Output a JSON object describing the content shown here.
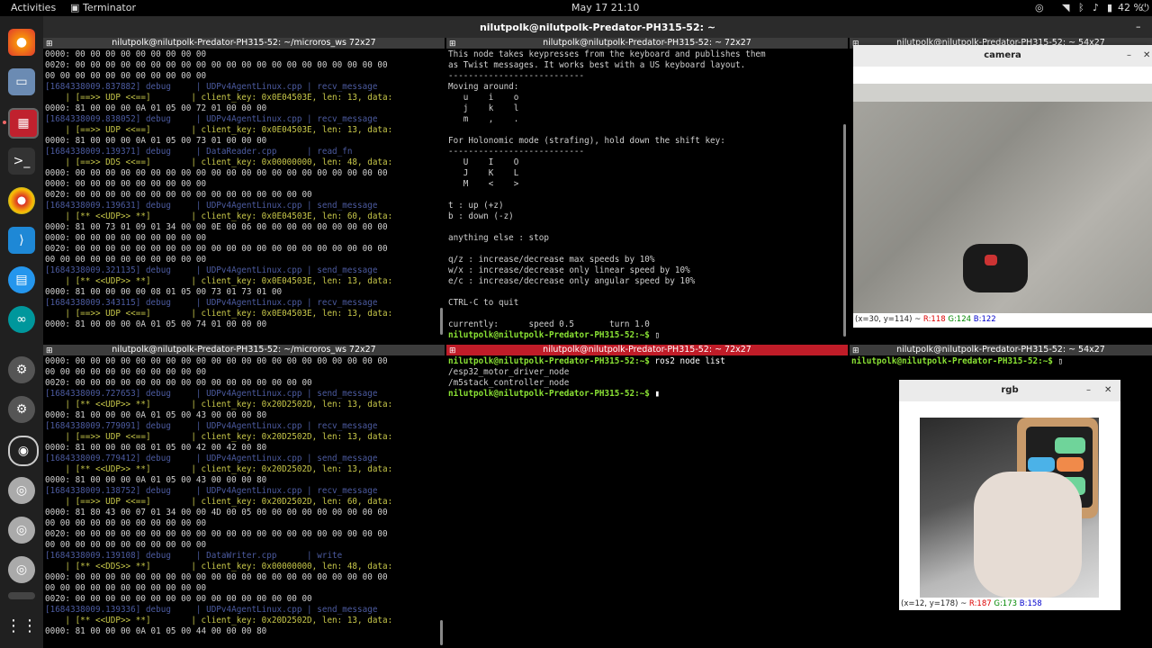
{
  "topbar": {
    "activities": "Activities",
    "app_name": "Terminator",
    "datetime": "May 17  21:10",
    "battery": "42 %"
  },
  "window_title": "nilutpolk@nilutpolk-Predator-PH315-52: ~",
  "panes": {
    "tl": {
      "title": "nilutpolk@nilutpolk-Predator-PH315-52: ~/microros_ws 72x27",
      "lines": [
        "0000: 00 00 00 00 00 00 00 00 00",
        "0020: 00 00 00 00 00 00 00 00 00 00 00 00 00 00 00 00 00 00 00 00 00",
        "00 00 00 00 00 00 00 00 00 00 00",
        "[1684338009.837882] debug     | UDPv4AgentLinux.cpp | recv_message",
        "    | [==>> UDP <<==]        | client_key: 0x0E04503E, len: 13, data:",
        "0000: 81 00 00 00 0A 01 05 00 72 01 00 00 00",
        "[1684338009.838052] debug     | UDPv4AgentLinux.cpp | recv_message",
        "    | [==>> UDP <<==]        | client_key: 0x0E04503E, len: 13, data:",
        "0000: 81 00 00 00 0A 01 05 00 73 01 00 00 00",
        "[1684338009.139371] debug     | DataReader.cpp      | read_fn",
        "    | [==>> DDS <<==]        | client_key: 0x00000000, len: 48, data:",
        "0000: 00 00 00 00 00 00 00 00 00 00 00 00 00 00 00 00 00 00 00 00 00",
        "0000: 00 00 00 00 00 00 00 00 00",
        "0020: 00 00 00 00 00 00 00 00 00 00 00 00 00 00 00 00",
        "[1684338009.139631] debug     | UDPv4AgentLinux.cpp | send_message",
        "    | [** <<UDP>> **]        | client_key: 0x0E04503E, len: 60, data:",
        "0000: 81 00 73 01 09 01 34 00 00 0E 00 06 00 00 00 00 00 00 00 00 00",
        "0000: 00 00 00 00 00 00 00 00 00",
        "0020: 00 00 00 00 00 00 00 00 00 00 00 00 00 00 00 00 00 00 00 00 00",
        "00 00 00 00 00 00 00 00 00 00 00",
        "[1684338009.321135] debug     | UDPv4AgentLinux.cpp | send_message",
        "    | [** <<UDP>> **]        | client_key: 0x0E04503E, len: 13, data:",
        "0000: 81 00 00 00 00 08 01 05 00 73 01 73 01 00",
        "[1684338009.343115] debug     | UDPv4AgentLinux.cpp | recv_message",
        "    | [==>> UDP <<==]        | client_key: 0x0E04503E, len: 13, data:",
        "0000: 81 00 00 00 0A 01 05 00 74 01 00 00 00"
      ]
    },
    "tm": {
      "title": "nilutpolk@nilutpolk-Predator-PH315-52: ~ 72x27",
      "lines": [
        "This node takes keypresses from the keyboard and publishes them",
        "as Twist messages. It works best with a US keyboard layout.",
        "---------------------------",
        "Moving around:",
        "   u    i    o",
        "   j    k    l",
        "   m    ,    .",
        "",
        "For Holonomic mode (strafing), hold down the shift key:",
        "---------------------------",
        "   U    I    O",
        "   J    K    L",
        "   M    <    >",
        "",
        "t : up (+z)",
        "b : down (-z)",
        "",
        "anything else : stop",
        "",
        "q/z : increase/decrease max speeds by 10%",
        "w/x : increase/decrease only linear speed by 10%",
        "e/c : increase/decrease only angular speed by 10%",
        "",
        "CTRL-C to quit",
        "",
        "currently:      speed 0.5       turn 1.0"
      ],
      "prompt": "nilutpolk@nilutpolk-Predator-PH315-52:~$"
    },
    "tr": {
      "title": "nilutpolk@nilutpolk-Predator-PH315-52: ~ 54x27"
    },
    "bl": {
      "title": "nilutpolk@nilutpolk-Predator-PH315-52: ~/microros_ws 72x27",
      "lines": [
        "0000: 00 00 00 00 00 00 00 00 00 00 00 00 00 00 00 00 00 00 00 00 00",
        "00 00 00 00 00 00 00 00 00 00 00",
        "0020: 00 00 00 00 00 00 00 00 00 00 00 00 00 00 00 00",
        "[1684338009.727653] debug     | UDPv4AgentLinux.cpp | send_message",
        "    | [** <<UDP>> **]        | client_key: 0x20D2502D, len: 13, data:",
        "0000: 81 00 00 00 0A 01 05 00 43 00 00 00 80",
        "[1684338009.779091] debug     | UDPv4AgentLinux.cpp | recv_message",
        "    | [==>> UDP <<==]        | client_key: 0x20D2502D, len: 13, data:",
        "0000: 81 00 00 00 08 01 05 00 42 00 42 00 80",
        "[1684338009.779412] debug     | UDPv4AgentLinux.cpp | send_message",
        "    | [** <<UDP>> **]        | client_key: 0x20D2502D, len: 13, data:",
        "0000: 81 00 00 00 0A 01 05 00 43 00 00 00 80",
        "[1684338009.138752] debug     | UDPv4AgentLinux.cpp | recv_message",
        "    | [==>> UDP <<==]        | client_key: 0x20D2502D, len: 60, data:",
        "0000: 81 80 43 00 07 01 34 00 00 4D 00 05 00 00 00 00 00 00 00 00 00",
        "00 00 00 00 00 00 00 00 00 00 00",
        "0020: 00 00 00 00 00 00 00 00 00 00 00 00 00 00 00 00 00 00 00 00 00",
        "00 00 00 00 00 00 00 00 00 00 00",
        "[1684338009.139108] debug     | DataWriter.cpp      | write",
        "    | [** <<DDS>> **]        | client_key: 0x00000000, len: 48, data:",
        "0000: 00 00 00 00 00 00 00 00 00 00 00 00 00 00 00 00 00 00 00 00 00",
        "00 00 00 00 00 00 00 00 00 00 00",
        "0020: 00 00 00 00 00 00 00 00 00 00 00 00 00 00 00 00",
        "[1684338009.139336] debug     | UDPv4AgentLinux.cpp | send_message",
        "    | [** <<UDP>> **]        | client_key: 0x20D2502D, len: 13, data:",
        "0000: 81 00 00 00 0A 01 05 00 44 00 00 00 80"
      ]
    },
    "bm": {
      "title": "nilutpolk@nilutpolk-Predator-PH315-52: ~ 72x27",
      "prompt": "nilutpolk@nilutpolk-Predator-PH315-52:~$",
      "command": " ros2 node list",
      "out1": "/esp32_motor_driver_node",
      "out2": "/m5stack_controller_node"
    },
    "br": {
      "title": "nilutpolk@nilutpolk-Predator-PH315-52: ~ 54x27",
      "prompt": "nilutpolk@nilutpolk-Predator-PH315-52:~$"
    }
  },
  "camera_window": {
    "title": "camera",
    "status_pos": "(x=30, y=114) ~ ",
    "status_r": "R:118",
    "status_g": "G:124",
    "status_b": "B:122"
  },
  "rgb_window": {
    "title": "rgb",
    "status_pos": "(x=12, y=178) ~ ",
    "status_r": "R:187",
    "status_g": "G:173",
    "status_b": "B:158"
  }
}
